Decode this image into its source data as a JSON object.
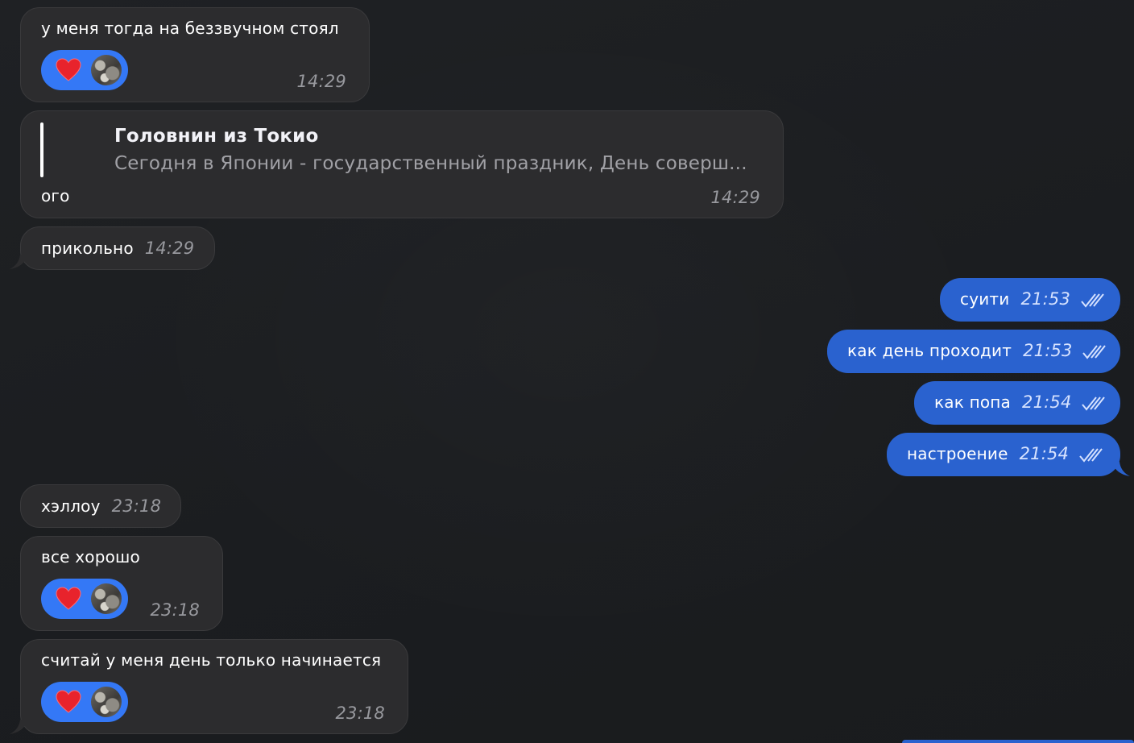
{
  "messages": {
    "m1": {
      "text": "у меня тогда на беззвучном стоял",
      "time": "14:29",
      "reaction": "heart-icon"
    },
    "m2": {
      "quote_title": "Головнин из Токио",
      "quote_text": "Сегодня в Японии - государственный праздник, День соверш...",
      "text": "ого",
      "time": "14:29"
    },
    "m3": {
      "text": "прикольно",
      "time": "14:29"
    },
    "m4": {
      "text": "суити",
      "time": "21:53"
    },
    "m5": {
      "text": "как день проходит",
      "time": "21:53"
    },
    "m6": {
      "text": "как попа",
      "time": "21:54"
    },
    "m7": {
      "text": "настроение",
      "time": "21:54"
    },
    "m8": {
      "text": "хэллоу",
      "time": "23:18"
    },
    "m9": {
      "text": "все хорошо",
      "time": "23:18",
      "reaction": "heart-icon"
    },
    "m10": {
      "text": "считай у меня день только начинается",
      "time": "23:18",
      "reaction": "heart-icon"
    }
  },
  "colors": {
    "background": "#1c1e21",
    "incoming_bubble": "#2c2c2e",
    "outgoing_bubble": "#2a62cf",
    "reaction_pill": "#3478f6",
    "timestamp": "#98999e"
  }
}
